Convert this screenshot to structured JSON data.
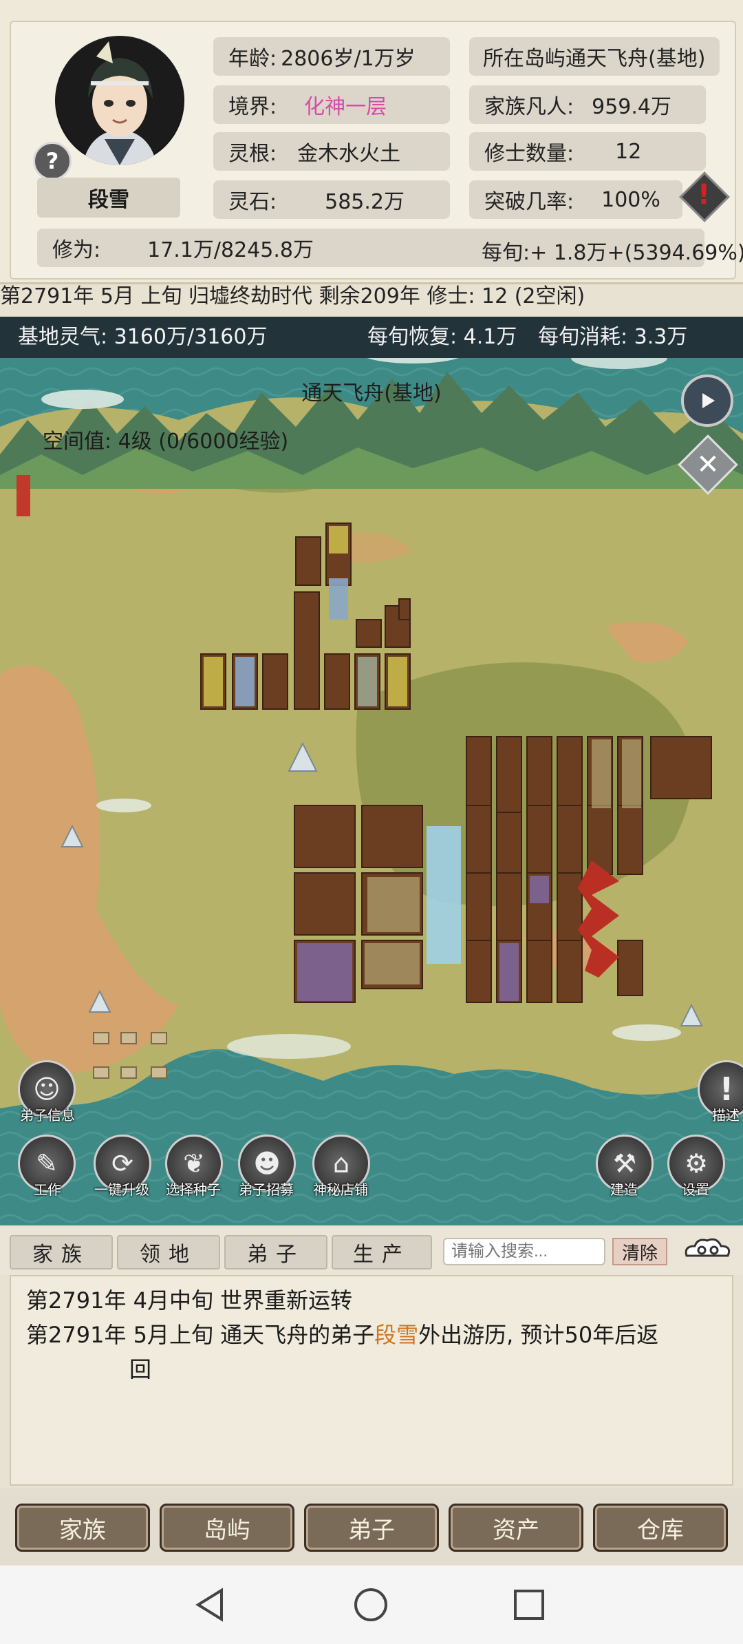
{
  "player": {
    "name": "段雪",
    "age_label": "年龄:",
    "age_value": "2806岁/1万岁",
    "realm_label": "境界:",
    "realm_value": "化神一层",
    "root_label": "灵根:",
    "root_value": "金木水火土",
    "stone_label": "灵石:",
    "stone_value": "585.2万",
    "island_label": "所在岛屿",
    "island_value": "通天飞舟(基地)",
    "mortals_label": "家族凡人:",
    "mortals_value": "959.4万",
    "cultivators_label": "修士数量:",
    "cultivators_value": "12",
    "breakthrough_label": "突破几率:",
    "breakthrough_value": "100%",
    "cultivation_label": "修为:",
    "cultivation_value": "17.1万/8245.8万",
    "per_cycle_label": "每旬:",
    "per_cycle_value": "+ 1.8万+(5394.69%)"
  },
  "era_line": "第2791年 5月 上旬  归墟终劫时代 剩余209年  修士: 12 (2空闲)",
  "base": {
    "qi_label": "基地灵气:",
    "qi_value": "3160万/3160万",
    "recover_label": "每旬恢复:",
    "recover_value": "4.1万",
    "consume_label": "每旬消耗:",
    "consume_value": "3.3万",
    "title": "通天飞舟(基地)",
    "space_value": "空间值: 4级 (0/6000经验)"
  },
  "map_buttons": {
    "disciple_info": "弟子信息",
    "work": "工作",
    "upgrade_all": "一键升级",
    "choose_seed": "选择种子",
    "recruit": "弟子招募",
    "mystic_shop": "神秘店铺",
    "build": "建造",
    "settings": "设置",
    "describe": "描述"
  },
  "log_tabs": [
    "家族",
    "领地",
    "弟子",
    "生产"
  ],
  "search": {
    "placeholder": "请输入搜索...",
    "clear": "清除"
  },
  "log": {
    "line1": "第2791年 4月中旬 世界重新运转",
    "line2_prefix": "第2791年 5月上旬 通天飞舟的弟子",
    "line2_name": "段雪",
    "line2_suffix": "外出游历, 预计50年后返",
    "line2_cont": "回"
  },
  "nav": [
    "家族",
    "岛屿",
    "弟子",
    "资产",
    "仓库"
  ],
  "colors": {
    "realm": "#d64aa8",
    "name_highlight": "#d0761c",
    "water": "#3e8a86",
    "land": "#b7b26a"
  }
}
